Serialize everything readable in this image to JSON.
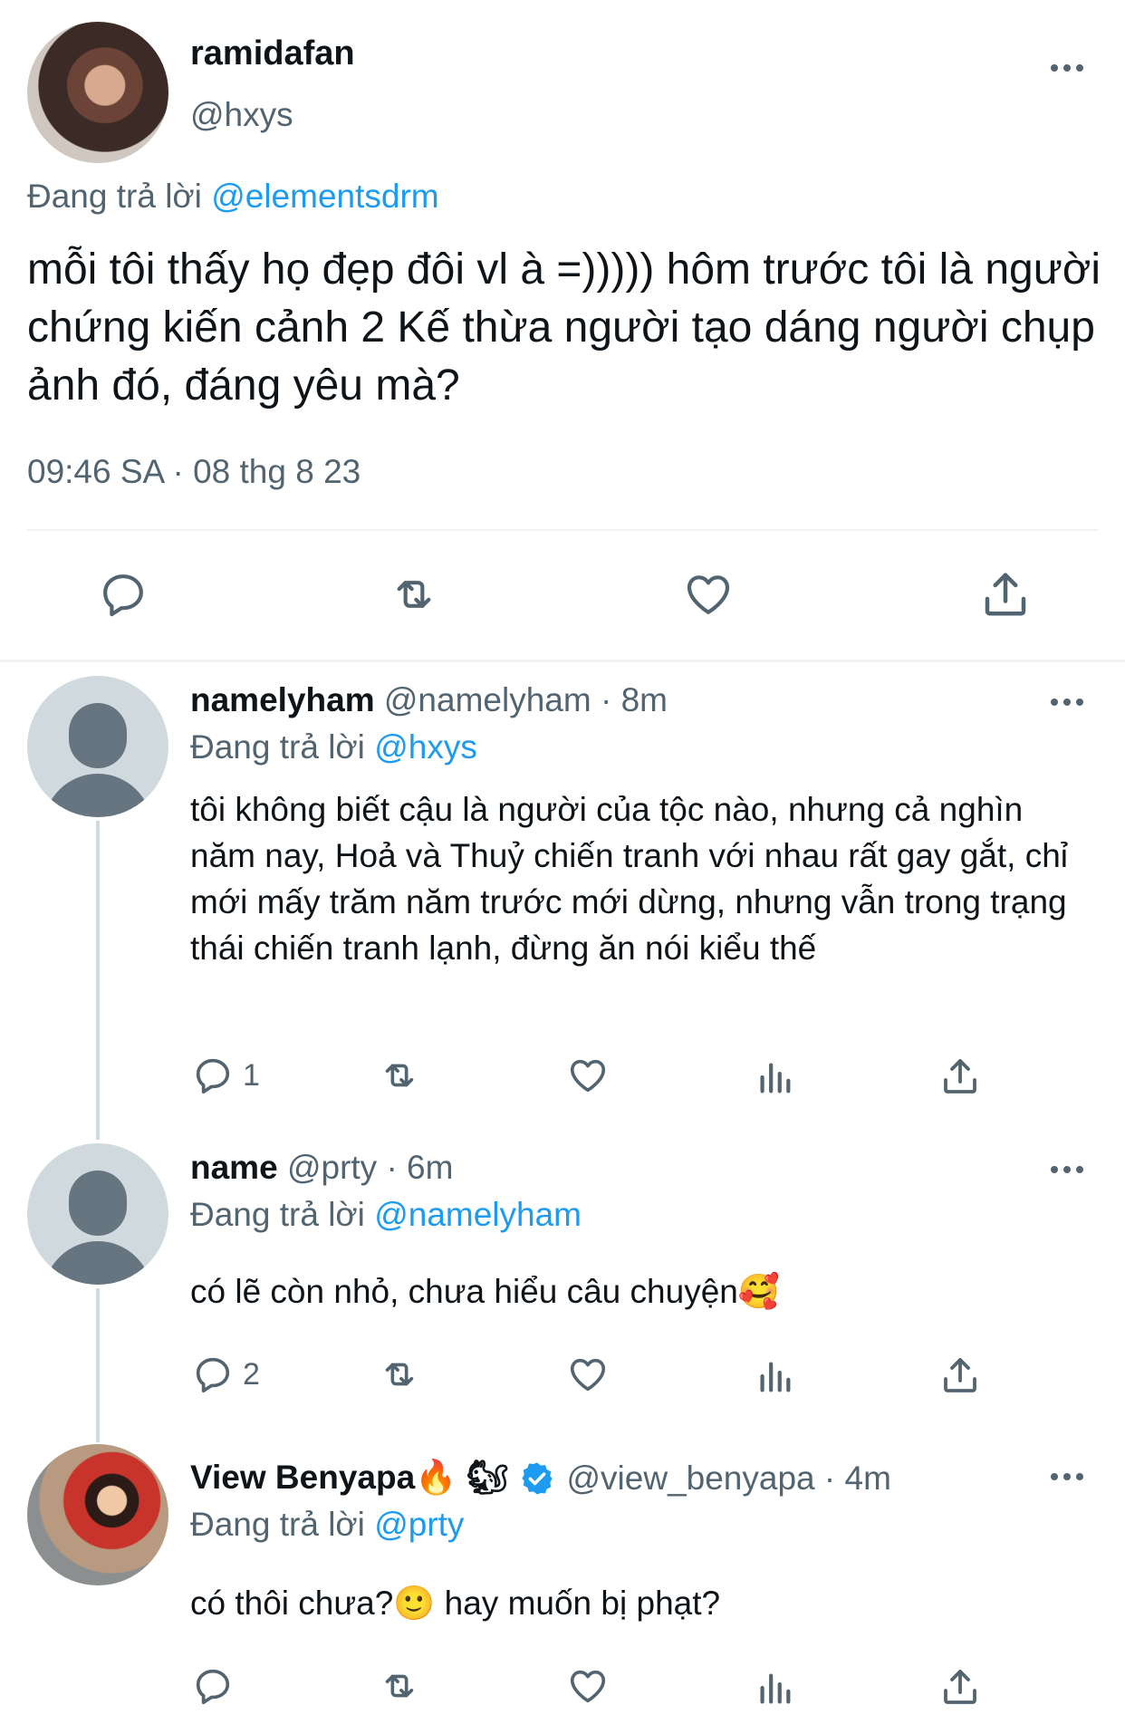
{
  "main_tweet": {
    "display_name": "ramidafan",
    "handle": "@hxys",
    "replying_prefix": "Đang trả lời",
    "replying_to": "@elementsdrm",
    "text": "mỗi tôi thấy họ đẹp đôi vl à =))))) hôm trước tôi là người chứng kiến cảnh 2 Kế thừa người tạo dáng người chụp ảnh đó, đáng yêu mà?",
    "timestamp": "09:46 SA · 08 thg 8 23"
  },
  "replies": [
    {
      "display_name": "namelyham",
      "handle_time": "@namelyham · 8m",
      "replying_prefix": "Đang trả lời",
      "replying_to": "@hxys",
      "text": "tôi không biết cậu là người của tộc nào, nhưng cả nghìn năm nay, Hoả và Thuỷ chiến tranh với nhau rất gay gắt, chỉ mới mấy trăm năm trước mới dừng, nhưng vẫn trong trạng thái chiến tranh lạnh, đừng ăn nói kiểu thế",
      "reply_count": "1"
    },
    {
      "display_name": "name",
      "handle_time": "@prty · 6m",
      "replying_prefix": "Đang trả lời",
      "replying_to": "@namelyham",
      "text": "có lẽ còn nhỏ, chưa hiểu câu chuyện🥰",
      "reply_count": "2"
    },
    {
      "display_name": "View Benyapa🔥 🐿",
      "handle_time": "@view_benyapa · 4m",
      "replying_prefix": "Đang trả lời",
      "replying_to": "@prty",
      "text": "có thôi chưa?🙂  hay muốn bị phạt?",
      "reply_count": ""
    }
  ],
  "colors": {
    "accent": "#1d9bf0",
    "muted": "#536471",
    "divider": "#eff3f4"
  }
}
